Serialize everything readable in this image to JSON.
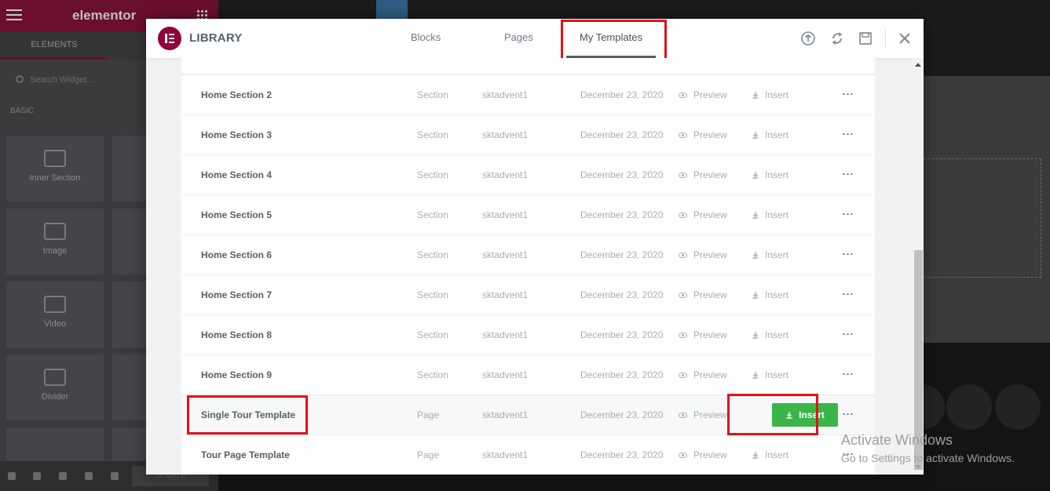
{
  "background": {
    "logo": "elementor",
    "panel_tab": "ELEMENTS",
    "search_placeholder": "Search Widget...",
    "section_label": "BASIC",
    "widgets": [
      "Inner Section",
      "Image",
      "Video",
      "Divider"
    ],
    "update_label": "UPDATE",
    "social_icons": [
      "instagram-icon",
      "youtube-icon",
      "linkedin-icon"
    ]
  },
  "modal": {
    "title": "LIBRARY",
    "tabs": [
      {
        "label": "Blocks"
      },
      {
        "label": "Pages"
      },
      {
        "label": "My Templates",
        "active": true
      }
    ],
    "header_icons": [
      "upload-icon",
      "sync-icon",
      "save-icon",
      "close-icon"
    ],
    "row_actions": {
      "preview": "Preview",
      "insert": "Insert"
    },
    "rows": [
      {
        "name": "Home Section 2",
        "type": "Section",
        "author": "sktadvent1",
        "date": "December 23, 2020"
      },
      {
        "name": "Home Section 3",
        "type": "Section",
        "author": "sktadvent1",
        "date": "December 23, 2020"
      },
      {
        "name": "Home Section 4",
        "type": "Section",
        "author": "sktadvent1",
        "date": "December 23, 2020"
      },
      {
        "name": "Home Section 5",
        "type": "Section",
        "author": "sktadvent1",
        "date": "December 23, 2020"
      },
      {
        "name": "Home Section 6",
        "type": "Section",
        "author": "sktadvent1",
        "date": "December 23, 2020"
      },
      {
        "name": "Home Section 7",
        "type": "Section",
        "author": "sktadvent1",
        "date": "December 23, 2020"
      },
      {
        "name": "Home Section 8",
        "type": "Section",
        "author": "sktadvent1",
        "date": "December 23, 2020"
      },
      {
        "name": "Home Section 9",
        "type": "Section",
        "author": "sktadvent1",
        "date": "December 23, 2020"
      },
      {
        "name": "Single Tour Template",
        "type": "Page",
        "author": "sktadvent1",
        "date": "December 23, 2020",
        "hovered": true
      },
      {
        "name": "Tour Page Template",
        "type": "Page",
        "author": "sktadvent1",
        "date": "December 23, 2020"
      }
    ]
  },
  "watermark": {
    "line1": "Activate Windows",
    "line2": "Go to Settings to activate Windows."
  },
  "colors": {
    "brand": "#92003b",
    "insert_green": "#39b54a",
    "highlight_red": "#e3101a"
  }
}
